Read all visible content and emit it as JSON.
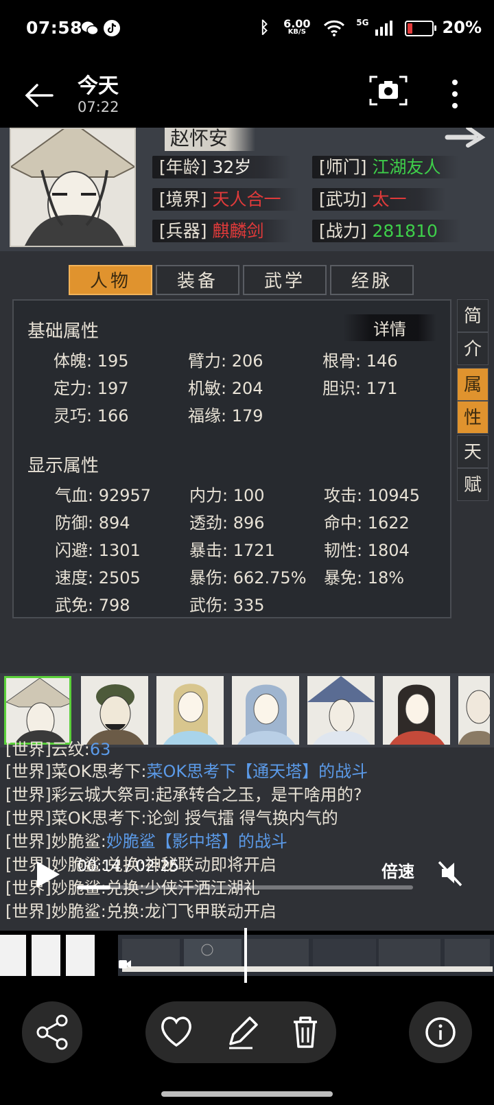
{
  "status_bar": {
    "time": "07:58",
    "net_speed": "6.00",
    "net_unit": "KB/S",
    "signal": "5G",
    "battery": "20%",
    "battery_level": 0.2
  },
  "header": {
    "title": "今天",
    "subtitle": "07:22"
  },
  "profile": {
    "name": "赵怀安",
    "stats": [
      {
        "label": "[年龄]",
        "value": "32岁",
        "color": "white"
      },
      {
        "label": "[师门]",
        "value": "江湖友人",
        "color": "green"
      },
      {
        "label": "[境界]",
        "value": "天人合一",
        "color": "red"
      },
      {
        "label": "[武功]",
        "value": "太一",
        "color": "red"
      },
      {
        "label": "[兵器]",
        "value": "麒麟剑",
        "color": "red"
      },
      {
        "label": "[战力]",
        "value": "281810",
        "color": "green"
      }
    ]
  },
  "tabs": [
    "人物",
    "装备",
    "武学",
    "经脉"
  ],
  "side_tabs": [
    "简",
    "介",
    "属",
    "性",
    "天",
    "赋"
  ],
  "panel": {
    "detail_label": "详情",
    "basic_title": "基础属性",
    "basic": [
      "体魄: 195",
      "臂力: 206",
      "根骨: 146",
      "定力: 197",
      "机敏: 204",
      "胆识: 171",
      "灵巧: 166",
      "福缘: 179"
    ],
    "display_title": "显示属性",
    "display": [
      "气血: 92957",
      "内力: 100",
      "攻击: 10945",
      "防御: 894",
      "透劲: 896",
      "命中: 1622",
      "闪避: 1301",
      "暴击: 1721",
      "韧性: 1804",
      "速度: 2505",
      "暴伤: 662.75%",
      "暴免: 18%",
      "武免: 798",
      "武伤: 335"
    ]
  },
  "chat": [
    {
      "tag": "[世界]",
      "user": "云纹:",
      "text": "63",
      "link": true
    },
    {
      "tag": "[世界]",
      "user": "菜OK思考下:",
      "text": "菜OK思考下【通天塔】的战斗",
      "link": true
    },
    {
      "tag": "[世界]",
      "user": "彩云城大祭司:",
      "text": "起承转合之玉，是干啥用的?",
      "link": false
    },
    {
      "tag": "[世界]",
      "user": "菜OK思考下:",
      "text": "论剑 授气擂 得气换内气的",
      "link": false
    },
    {
      "tag": "[世界]",
      "user": "妙脆鲨:",
      "text": "妙脆鲨【影中塔】的战斗",
      "link": true
    },
    {
      "tag": "[世界]",
      "user": "妙脆鲨:",
      "text": "兑换:神秘联动即将开启",
      "link": false
    },
    {
      "tag": "[世界]",
      "user": "妙脆鲨:",
      "text": "兑换:少侠汗洒江湖礼",
      "link": false
    },
    {
      "tag": "[世界]",
      "user": "妙脆鲨:",
      "text": "兑换:龙门飞甲联动开启",
      "link": false
    }
  ],
  "video": {
    "time": "00:14 / 02:25",
    "speed_label": "倍速",
    "progress": 0.1
  }
}
